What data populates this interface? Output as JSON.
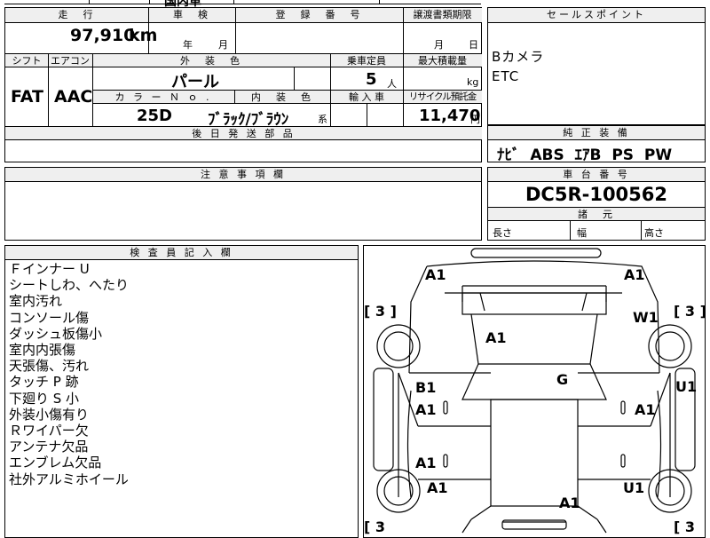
{
  "header_top": {
    "truncated_text": "国内車"
  },
  "mileage": {
    "label": "走　行",
    "value": "97,910",
    "unit": "km"
  },
  "inspection": {
    "label": "車　検",
    "year_unit": "年",
    "month_unit": "月"
  },
  "registration": {
    "label": "登　録　番　号",
    "value": ""
  },
  "transfer_deadline": {
    "label": "譲渡書類期限",
    "month_unit": "月",
    "day_unit": "日"
  },
  "sales_points": {
    "label": "セールスポイント",
    "items": [
      "Bカメラ",
      "ETC"
    ]
  },
  "shift": {
    "label": "シフト",
    "value": "FAT"
  },
  "aircon": {
    "label": "エアコン",
    "value": "AAC"
  },
  "exterior_color": {
    "label": "外　装　色",
    "value": "パール"
  },
  "capacity": {
    "label": "乗車定員",
    "value": "5",
    "unit": "人"
  },
  "max_load": {
    "label": "最大積載量",
    "unit": "kg"
  },
  "color_no": {
    "label": "カ ラ ー Ｎ ｏ .",
    "value": "25D"
  },
  "interior_color": {
    "label": "内　装　色",
    "value": "ﾌﾞﾗｯｸ/ﾌﾞﾗｳﾝ",
    "suffix": "系"
  },
  "import_car": {
    "label": "輸 入 車"
  },
  "recycle_fee": {
    "label": "リサイクル預託金",
    "value": "11,470",
    "unit": "円"
  },
  "later_parts": {
    "label": "後 日 発 送 部 品"
  },
  "equipment": {
    "label": "純 正 装 備",
    "value": "ﾅﾋﾞ  ABS  ｴｱB  PS  PW"
  },
  "notes_section": {
    "label": "注 意 事 項 欄"
  },
  "chassis": {
    "label": "車 台 番 号",
    "value": "DC5R-100562"
  },
  "specs": {
    "label": "諸　元",
    "length": "長さ",
    "width": "幅",
    "height": "高さ"
  },
  "inspector": {
    "label": "検 査 員 記 入 欄",
    "notes": [
      "Ｆインナー U",
      "シートしわ、へたり",
      "室内汚れ",
      "コンソール傷",
      "ダッシュ板傷小",
      "室内内張傷",
      "天張傷、汚れ",
      "タッチ P 跡",
      "下廻り S 小",
      "外装小傷有り",
      "Ｒワイパー欠",
      "アンテナ欠品",
      "エンブレム欠品",
      "社外アルミホイール"
    ]
  },
  "diagram": {
    "marks": {
      "front_left": "A1",
      "front_right": "A1",
      "hood": "A1",
      "right_fender": "W1",
      "roof": "G",
      "left_front_door_b": "B1",
      "left_front_door_a": "A1",
      "right_front_door": "A1",
      "right_side": "U1",
      "left_rear_door": "A1",
      "left_rear_fender": "A1",
      "right_rear_fender": "U1",
      "trunk": "A1"
    },
    "tire_top_left": "[ 3 ]",
    "tire_top_right": "[ 3 ]",
    "tire_bottom_left": "[ 3",
    "tire_bottom_right": "[ 3"
  }
}
